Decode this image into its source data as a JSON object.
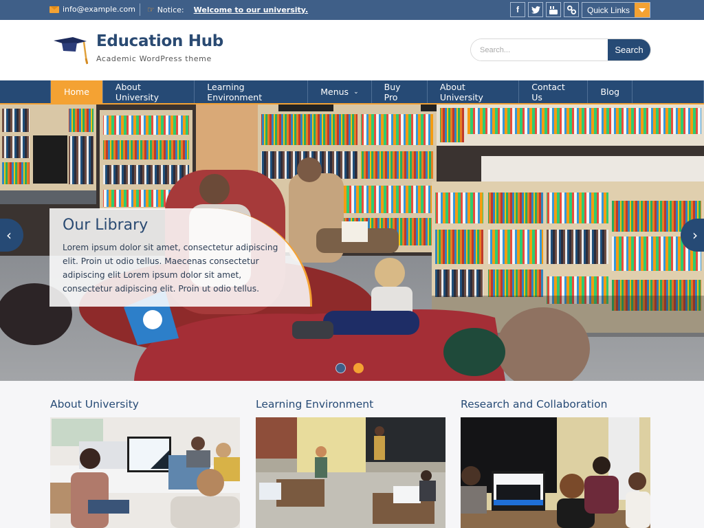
{
  "topbar": {
    "email": "info@example.com",
    "notice_label": "Notice:",
    "notice_link": "Welcome to our university.",
    "socials": [
      {
        "name": "facebook",
        "glyph": "f"
      },
      {
        "name": "twitter",
        "glyph": "t"
      },
      {
        "name": "youtube",
        "glyph": "▶"
      },
      {
        "name": "link",
        "glyph": "∞"
      }
    ],
    "quick_links_label": "Quick Links"
  },
  "header": {
    "title": "Education Hub",
    "tagline": "Academic WordPress theme",
    "search_placeholder": "Search...",
    "search_button": "Search"
  },
  "nav": {
    "items": [
      {
        "label": "Home",
        "active": true
      },
      {
        "label": "About University"
      },
      {
        "label": "Learning Environment"
      },
      {
        "label": "Menus",
        "has_dropdown": true
      },
      {
        "label": "Buy Pro"
      },
      {
        "label": "About University"
      },
      {
        "label": "Contact Us"
      },
      {
        "label": "Blog"
      }
    ]
  },
  "hero": {
    "title": "Our Library",
    "text": "Lorem ipsum dolor sit amet, consectetur adipiscing elit. Proin ut odio tellus. Maecenas consectetur adipiscing elit Lorem ipsum dolor sit amet, consectetur adipiscing elit. Proin ut odio tellus.",
    "prev_glyph": "‹",
    "next_glyph": "›",
    "slides_total": 2,
    "active_slide": 2
  },
  "features": [
    {
      "title": "About University",
      "image": "office-workspace"
    },
    {
      "title": "Learning Environment",
      "image": "classroom"
    },
    {
      "title": "Research and Collaboration",
      "image": "meeting"
    }
  ],
  "colors": {
    "primary": "#264a75",
    "topbar": "#3f5f88",
    "accent": "#f4a233"
  }
}
